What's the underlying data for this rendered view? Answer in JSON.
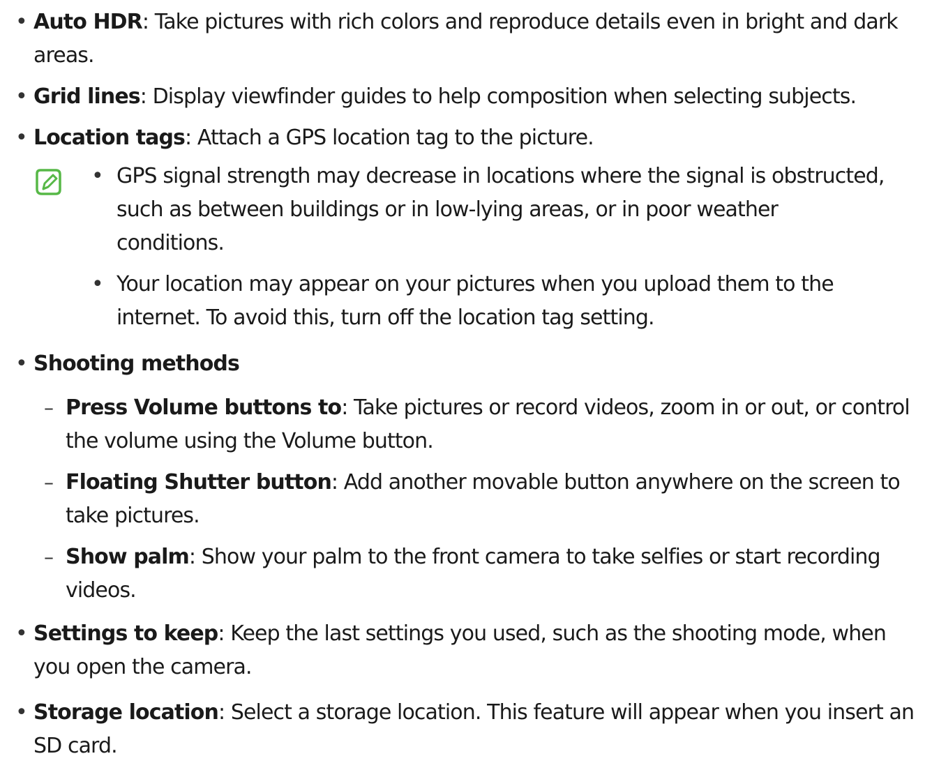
{
  "items": [
    {
      "term": "Auto HDR",
      "desc": ": Take pictures with rich colors and reproduce details even in bright and dark areas."
    },
    {
      "term": "Grid lines",
      "desc": ": Display viewfinder guides to help composition when selecting subjects."
    },
    {
      "term": "Location tags",
      "desc": ": Attach a GPS location tag to the picture."
    },
    {
      "term": "Shooting methods",
      "desc": ""
    },
    {
      "term": "Settings to keep",
      "desc": ": Keep the last settings you used, such as the shooting mode, when you open the camera."
    },
    {
      "term": "Storage location",
      "desc": ": Select a storage location. This feature will appear when you insert an SD card."
    }
  ],
  "notes": [
    "GPS signal strength may decrease in locations where the signal is obstructed, such as between buildings or in low-lying areas, or in poor weather conditions.",
    "Your location may appear on your pictures when you upload them to the internet. To avoid this, turn off the location tag setting."
  ],
  "sub_items": [
    {
      "term": "Press Volume buttons to",
      "desc": ": Take pictures or record videos, zoom in or out, or control the volume using the Volume button."
    },
    {
      "term": "Floating Shutter button",
      "desc": ": Add another movable button anywhere on the screen to take pictures."
    },
    {
      "term": "Show palm",
      "desc": ": Show your palm to the front camera to take selfies or start recording videos."
    }
  ],
  "bullet_char": "•",
  "dash_char": "–",
  "colors": {
    "note_icon": "#57b847",
    "text": "#1a1a1a"
  },
  "icons": {
    "note": "note-pencil-icon"
  }
}
